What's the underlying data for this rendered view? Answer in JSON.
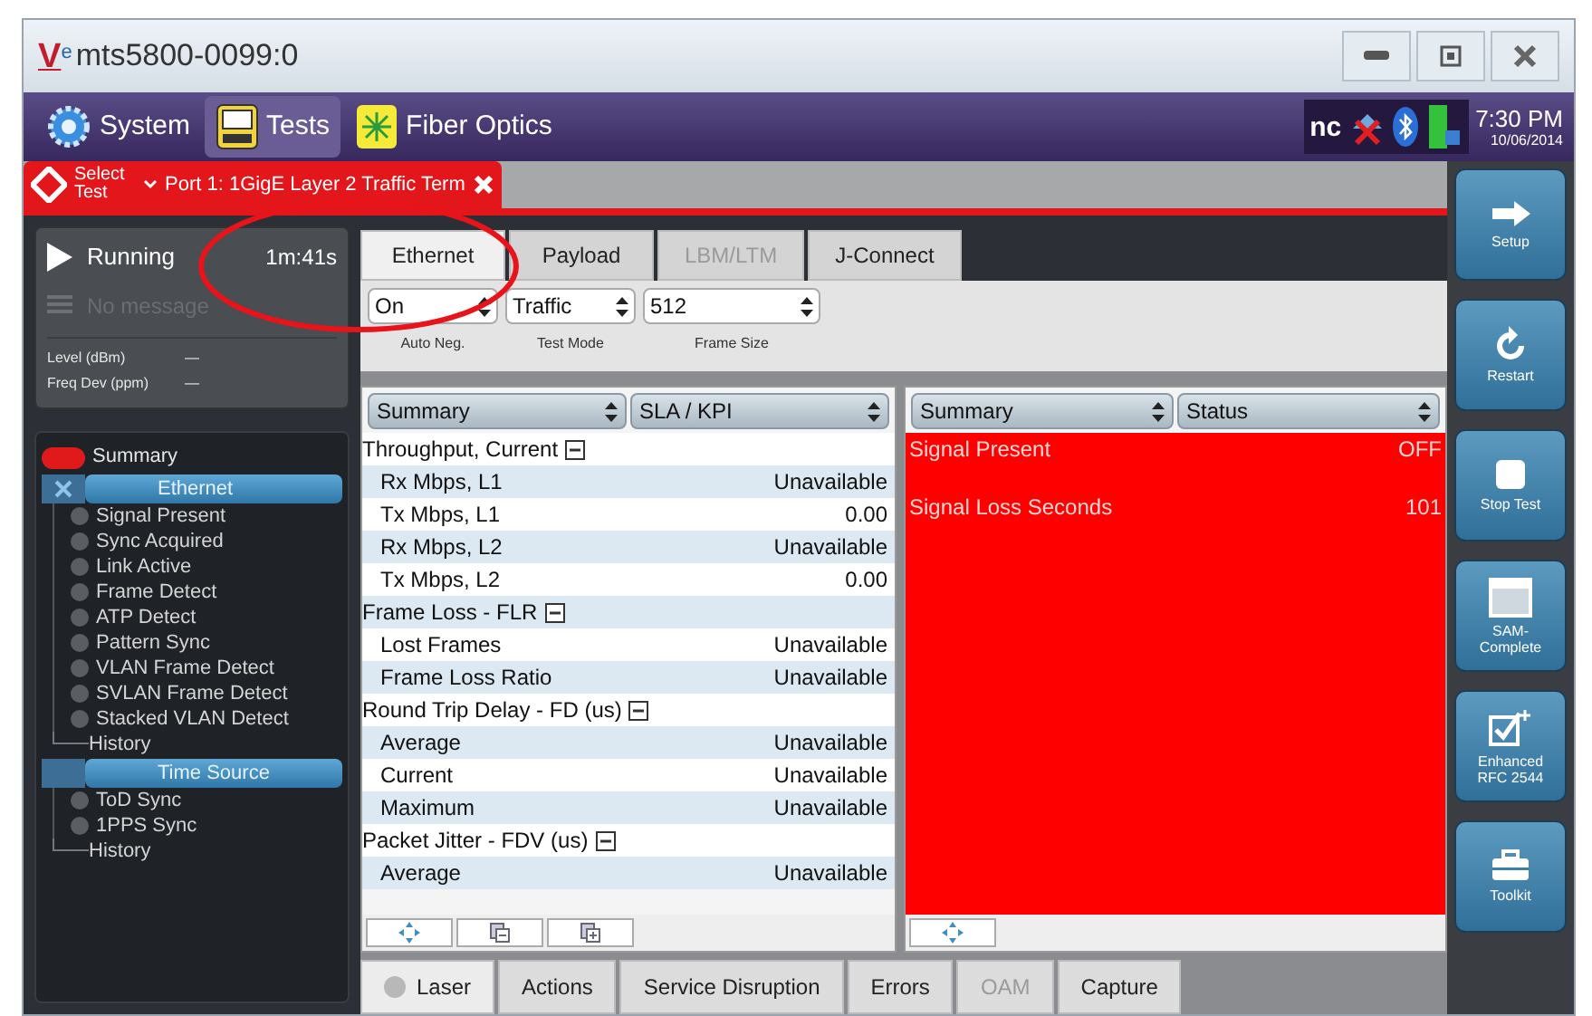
{
  "window": {
    "title": "mts5800-0099:0",
    "logo": "V",
    "logo_sub": "e"
  },
  "menu": [
    {
      "label": "System",
      "kind": "gear",
      "selected": false
    },
    {
      "label": "Tests",
      "kind": "bert",
      "selected": true
    },
    {
      "label": "Fiber Optics",
      "kind": "fiber",
      "selected": false
    }
  ],
  "status_area": {
    "nc_label": "nc",
    "time": "7:30 PM",
    "date": "10/06/2014"
  },
  "test_tab": {
    "select_label": "Select Test",
    "title": "Port 1: 1GigE Layer 2 Traffic Term"
  },
  "run_status": {
    "state": "Running",
    "elapsed": "1m:41s",
    "message": "No message",
    "readings": [
      {
        "label": "Level (dBm)",
        "value": "—"
      },
      {
        "label": "Freq Dev (ppm)",
        "value": "—"
      }
    ]
  },
  "tree": [
    {
      "label": "Summary",
      "kind": "led",
      "color": "#e0191b"
    },
    {
      "label": "Ethernet",
      "kind": "group",
      "expanded": true,
      "children": [
        {
          "label": "Signal Present",
          "color": "#5a5d62"
        },
        {
          "label": "Sync Acquired",
          "color": "#5a5d62"
        },
        {
          "label": "Link Active",
          "color": "#5a5d62"
        },
        {
          "label": "Frame Detect",
          "color": "#5a5d62"
        },
        {
          "label": "ATP Detect",
          "color": "#5a5d62"
        },
        {
          "label": "Pattern Sync",
          "color": "#5a5d62"
        },
        {
          "label": "VLAN Frame Detect",
          "color": "#5a5d62"
        },
        {
          "label": "SVLAN Frame Detect",
          "color": "#5a5d62"
        },
        {
          "label": "Stacked VLAN Detect",
          "color": "#5a5d62"
        },
        {
          "label": "History",
          "kind": "history"
        }
      ]
    },
    {
      "label": "Time Source",
      "kind": "group",
      "expanded": false,
      "children": [
        {
          "label": "ToD Sync",
          "color": "#5a5d62"
        },
        {
          "label": "1PPS Sync",
          "color": "#5a5d62"
        },
        {
          "label": "History",
          "kind": "history"
        }
      ]
    }
  ],
  "tabs": [
    {
      "label": "Ethernet",
      "selected": true,
      "disabled": false
    },
    {
      "label": "Payload",
      "selected": false,
      "disabled": false
    },
    {
      "label": "LBM/LTM",
      "selected": false,
      "disabled": true
    },
    {
      "label": "J-Connect",
      "selected": false,
      "disabled": false
    }
  ],
  "settings": [
    {
      "value": "On",
      "label": "Auto Neg."
    },
    {
      "value": "Traffic",
      "label": "Test Mode"
    },
    {
      "value": "512",
      "label": "Frame Size"
    }
  ],
  "left_table": {
    "selectors": [
      "Summary",
      "SLA / KPI"
    ],
    "rows": [
      {
        "kind": "group",
        "label": "Throughput, Current",
        "expanded": true
      },
      {
        "kind": "row",
        "label": "Rx Mbps, L1",
        "value": "Unavailable"
      },
      {
        "kind": "row",
        "label": "Tx Mbps, L1",
        "value": "0.00"
      },
      {
        "kind": "row",
        "label": "Rx Mbps, L2",
        "value": "Unavailable"
      },
      {
        "kind": "row",
        "label": "Tx Mbps, L2",
        "value": "0.00"
      },
      {
        "kind": "group",
        "label": "Frame Loss - FLR",
        "expanded": true
      },
      {
        "kind": "row",
        "label": "Lost Frames",
        "value": "Unavailable"
      },
      {
        "kind": "row",
        "label": "Frame Loss Ratio",
        "value": "Unavailable"
      },
      {
        "kind": "group",
        "label": "Round Trip Delay - FD (us)",
        "expanded": true
      },
      {
        "kind": "row",
        "label": "Average",
        "value": "Unavailable"
      },
      {
        "kind": "row",
        "label": "Current",
        "value": "Unavailable"
      },
      {
        "kind": "row",
        "label": "Maximum",
        "value": "Unavailable"
      },
      {
        "kind": "group",
        "label": "Packet Jitter - FDV (us)",
        "expanded": true
      },
      {
        "kind": "row",
        "label": "Average",
        "value": "Unavailable"
      }
    ]
  },
  "right_table": {
    "selectors": [
      "Summary",
      "Status"
    ],
    "alarm": true,
    "rows": [
      {
        "label": "Signal Present",
        "value": "OFF"
      },
      {
        "label": "Signal Loss Seconds",
        "value": "101"
      }
    ]
  },
  "bottom_tabs": [
    {
      "label": "Laser",
      "kind": "led",
      "disabled": false
    },
    {
      "label": "Actions",
      "disabled": false
    },
    {
      "label": "Service Disruption",
      "disabled": false
    },
    {
      "label": "Errors",
      "disabled": false
    },
    {
      "label": "OAM",
      "disabled": true
    },
    {
      "label": "Capture",
      "disabled": false
    }
  ],
  "actions": [
    {
      "label": "Setup",
      "kind": "arrow"
    },
    {
      "label": "Restart",
      "kind": "restart"
    },
    {
      "label": "Stop Test",
      "kind": "stop"
    },
    {
      "label": "SAM-Complete",
      "kind": "window"
    },
    {
      "label": "Enhanced RFC 2544",
      "kind": "check"
    },
    {
      "label": "Toolkit",
      "kind": "toolbox"
    }
  ]
}
